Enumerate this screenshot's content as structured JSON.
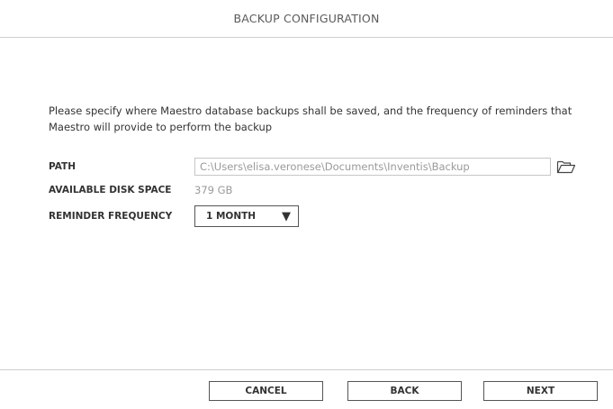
{
  "window": {
    "title": "BACKUP CONFIGURATION"
  },
  "description": "Please specify where Maestro database backups shall be saved, and the frequency of reminders that Maestro will provide to perform the backup",
  "form": {
    "path_label": "PATH",
    "path_value": "C:\\Users\\elisa.veronese\\Documents\\Inventis\\Backup",
    "browse_icon": "folder-open-icon",
    "disk_label": "AVAILABLE DISK SPACE",
    "disk_value": "379 GB",
    "freq_label": "REMINDER FREQUENCY",
    "freq_value": "1 MONTH",
    "freq_arrow": "▼"
  },
  "footer": {
    "cancel_label": "CANCEL",
    "back_label": "BACK",
    "next_label": "NEXT"
  },
  "colors": {
    "border": "#cfcfcf",
    "muted_text": "#9a9a9a",
    "text": "#333333"
  }
}
